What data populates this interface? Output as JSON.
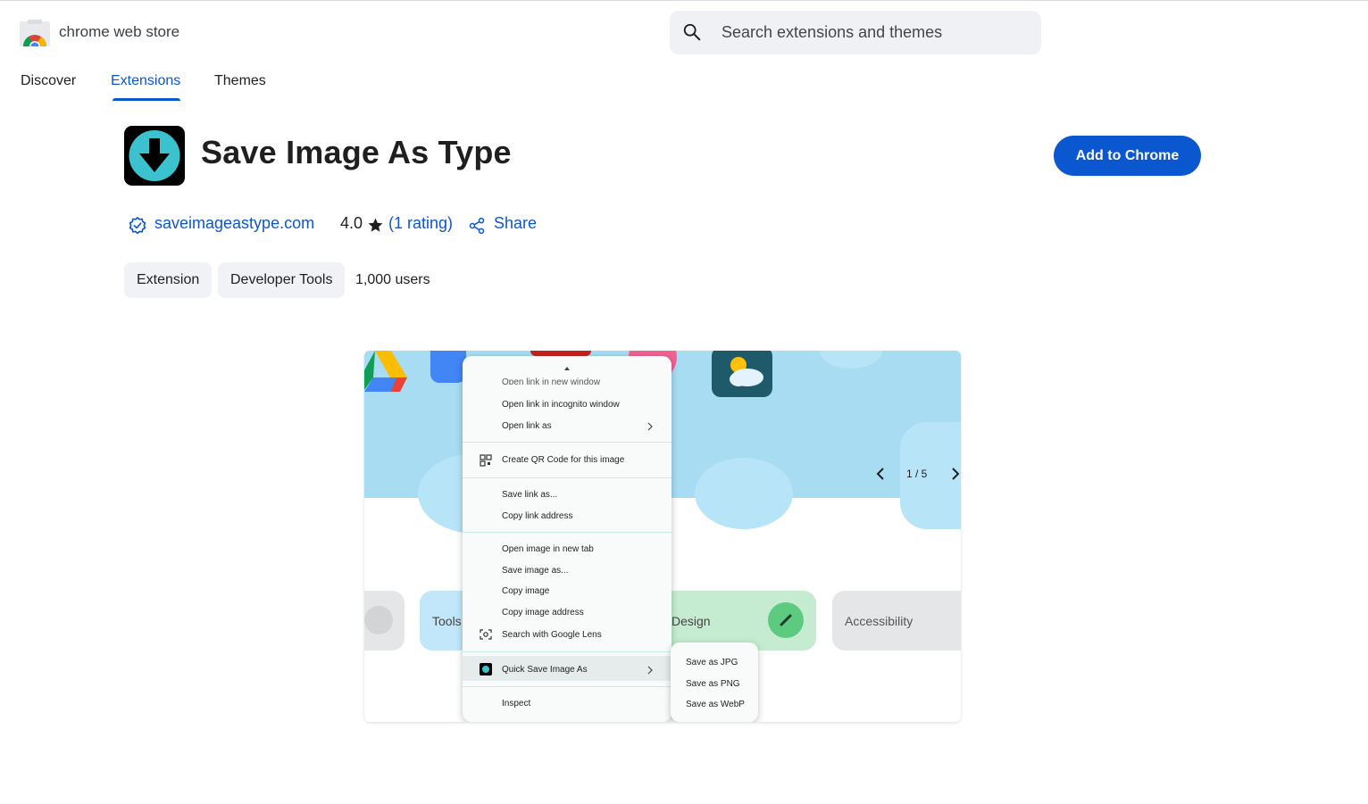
{
  "header": {
    "brand": "chrome web store",
    "search_placeholder": "Search extensions and themes"
  },
  "nav": {
    "items": [
      "Discover",
      "Extensions",
      "Themes"
    ],
    "active": "Extensions"
  },
  "extension": {
    "title": "Save Image As Type",
    "add_button": "Add to Chrome",
    "website": "saveimageastype.com",
    "rating": "4.0",
    "rating_open": "(",
    "rating_link": "1 rating",
    "rating_close": ")",
    "share": "Share",
    "chips": [
      "Extension",
      "Developer Tools"
    ],
    "users": "1,000 users"
  },
  "screenshot": {
    "pager": "1 / 5",
    "categories": [
      "Tools",
      "Design",
      "Accessibility"
    ],
    "context_menu": {
      "items": [
        "Open link in new window",
        "Open link in incognito window",
        "Open link as",
        "Create QR Code for this image",
        "Save link as...",
        "Copy link address",
        "Open image in new tab",
        "Save image as...",
        "Copy image",
        "Copy image address",
        "Search with Google Lens",
        "Quick Save Image As",
        "Inspect"
      ],
      "submenu": [
        "Save as JPG",
        "Save as PNG",
        "Save as WebP"
      ]
    }
  },
  "colors": {
    "accent": "#0b57d0",
    "chip_bg": "#f0f2f5",
    "icon_teal": "#3ac3cf"
  }
}
